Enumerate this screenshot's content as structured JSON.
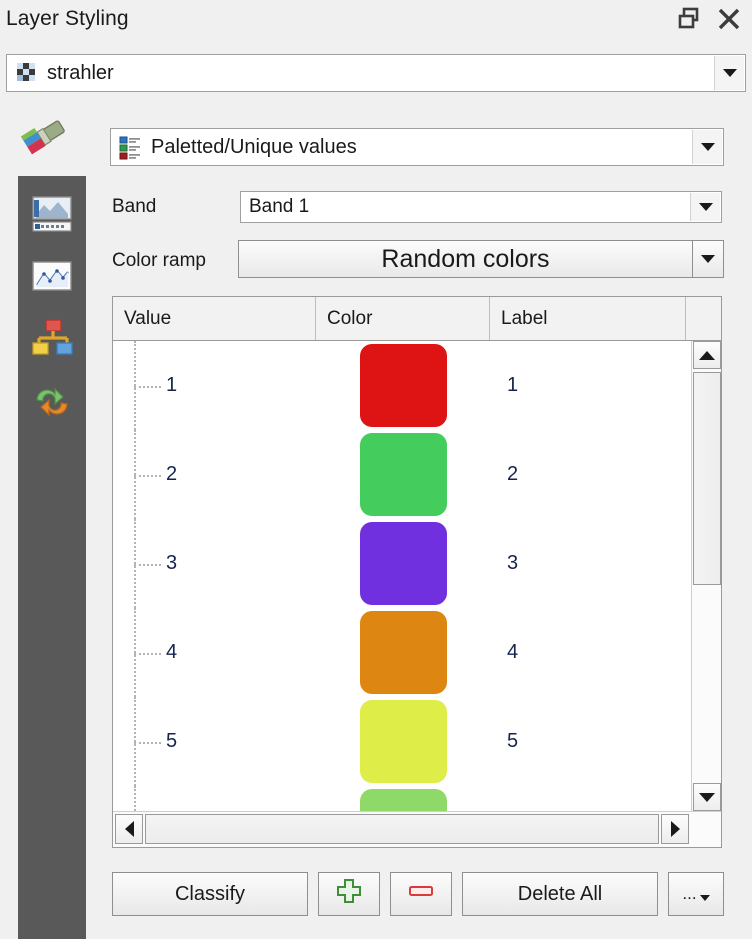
{
  "panel": {
    "title": "Layer Styling",
    "float_icon": "float-window-icon",
    "close_icon": "close-icon"
  },
  "layer_selector": {
    "icon": "raster-layer-icon",
    "value": "strahler",
    "arrow_icon": "chevron-down-icon"
  },
  "rail": {
    "brush_icon": "paintbrush-icon",
    "items": [
      {
        "icon": "symbology-raster-icon",
        "name": "symbology"
      },
      {
        "icon": "histogram-icon",
        "name": "histogram"
      },
      {
        "icon": "rendering-pyramid-icon",
        "name": "rendering"
      },
      {
        "icon": "undo-redo-icon",
        "name": "history"
      }
    ]
  },
  "renderer": {
    "icon": "paletted-values-icon",
    "value": "Paletted/Unique values",
    "arrow_icon": "chevron-down-icon"
  },
  "band": {
    "label": "Band",
    "value": "Band 1",
    "arrow_icon": "chevron-down-icon"
  },
  "color_ramp": {
    "label": "Color ramp",
    "value": "Random colors",
    "arrow_icon": "chevron-down-icon"
  },
  "table": {
    "columns": [
      "Value",
      "Color",
      "Label"
    ],
    "sort_indicator_icon": "sort-ascending-icon",
    "rows": [
      {
        "value": "1",
        "color": "#DE1414",
        "label": "1"
      },
      {
        "value": "2",
        "color": "#44CC5C",
        "label": "2"
      },
      {
        "value": "3",
        "color": "#7030E0",
        "label": "3"
      },
      {
        "value": "4",
        "color": "#DD8612",
        "label": "4"
      },
      {
        "value": "5",
        "color": "#DFED48",
        "label": "5"
      },
      {
        "value": "",
        "color": "#8ED968",
        "label": ""
      }
    ]
  },
  "scrollbars": {
    "v_up_icon": "triangle-up-icon",
    "v_down_icon": "triangle-down-icon",
    "h_left_icon": "triangle-left-icon",
    "h_right_icon": "triangle-right-icon"
  },
  "buttons": {
    "classify": "Classify",
    "add_icon": "plus-icon",
    "remove_icon": "minus-icon",
    "delete_all": "Delete All",
    "more": "..."
  }
}
